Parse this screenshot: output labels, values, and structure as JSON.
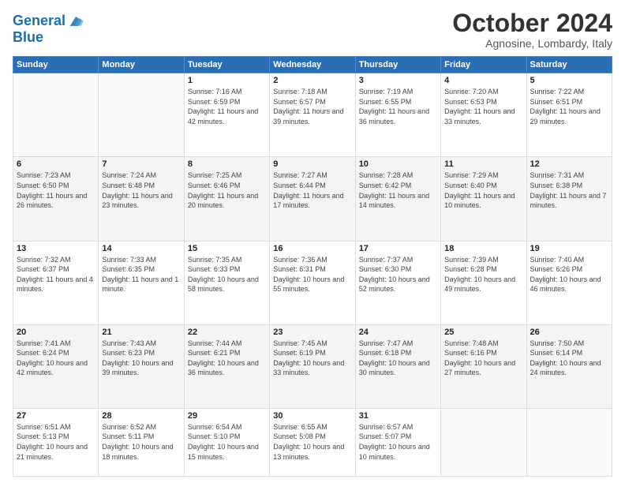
{
  "logo": {
    "line1": "General",
    "line2": "Blue"
  },
  "header": {
    "month": "October 2024",
    "location": "Agnosine, Lombardy, Italy"
  },
  "weekdays": [
    "Sunday",
    "Monday",
    "Tuesday",
    "Wednesday",
    "Thursday",
    "Friday",
    "Saturday"
  ],
  "weeks": [
    [
      {
        "day": "",
        "sunrise": "",
        "sunset": "",
        "daylight": ""
      },
      {
        "day": "",
        "sunrise": "",
        "sunset": "",
        "daylight": ""
      },
      {
        "day": "1",
        "sunrise": "Sunrise: 7:16 AM",
        "sunset": "Sunset: 6:59 PM",
        "daylight": "Daylight: 11 hours and 42 minutes."
      },
      {
        "day": "2",
        "sunrise": "Sunrise: 7:18 AM",
        "sunset": "Sunset: 6:57 PM",
        "daylight": "Daylight: 11 hours and 39 minutes."
      },
      {
        "day": "3",
        "sunrise": "Sunrise: 7:19 AM",
        "sunset": "Sunset: 6:55 PM",
        "daylight": "Daylight: 11 hours and 36 minutes."
      },
      {
        "day": "4",
        "sunrise": "Sunrise: 7:20 AM",
        "sunset": "Sunset: 6:53 PM",
        "daylight": "Daylight: 11 hours and 33 minutes."
      },
      {
        "day": "5",
        "sunrise": "Sunrise: 7:22 AM",
        "sunset": "Sunset: 6:51 PM",
        "daylight": "Daylight: 11 hours and 29 minutes."
      }
    ],
    [
      {
        "day": "6",
        "sunrise": "Sunrise: 7:23 AM",
        "sunset": "Sunset: 6:50 PM",
        "daylight": "Daylight: 11 hours and 26 minutes."
      },
      {
        "day": "7",
        "sunrise": "Sunrise: 7:24 AM",
        "sunset": "Sunset: 6:48 PM",
        "daylight": "Daylight: 11 hours and 23 minutes."
      },
      {
        "day": "8",
        "sunrise": "Sunrise: 7:25 AM",
        "sunset": "Sunset: 6:46 PM",
        "daylight": "Daylight: 11 hours and 20 minutes."
      },
      {
        "day": "9",
        "sunrise": "Sunrise: 7:27 AM",
        "sunset": "Sunset: 6:44 PM",
        "daylight": "Daylight: 11 hours and 17 minutes."
      },
      {
        "day": "10",
        "sunrise": "Sunrise: 7:28 AM",
        "sunset": "Sunset: 6:42 PM",
        "daylight": "Daylight: 11 hours and 14 minutes."
      },
      {
        "day": "11",
        "sunrise": "Sunrise: 7:29 AM",
        "sunset": "Sunset: 6:40 PM",
        "daylight": "Daylight: 11 hours and 10 minutes."
      },
      {
        "day": "12",
        "sunrise": "Sunrise: 7:31 AM",
        "sunset": "Sunset: 6:38 PM",
        "daylight": "Daylight: 11 hours and 7 minutes."
      }
    ],
    [
      {
        "day": "13",
        "sunrise": "Sunrise: 7:32 AM",
        "sunset": "Sunset: 6:37 PM",
        "daylight": "Daylight: 11 hours and 4 minutes."
      },
      {
        "day": "14",
        "sunrise": "Sunrise: 7:33 AM",
        "sunset": "Sunset: 6:35 PM",
        "daylight": "Daylight: 11 hours and 1 minute."
      },
      {
        "day": "15",
        "sunrise": "Sunrise: 7:35 AM",
        "sunset": "Sunset: 6:33 PM",
        "daylight": "Daylight: 10 hours and 58 minutes."
      },
      {
        "day": "16",
        "sunrise": "Sunrise: 7:36 AM",
        "sunset": "Sunset: 6:31 PM",
        "daylight": "Daylight: 10 hours and 55 minutes."
      },
      {
        "day": "17",
        "sunrise": "Sunrise: 7:37 AM",
        "sunset": "Sunset: 6:30 PM",
        "daylight": "Daylight: 10 hours and 52 minutes."
      },
      {
        "day": "18",
        "sunrise": "Sunrise: 7:39 AM",
        "sunset": "Sunset: 6:28 PM",
        "daylight": "Daylight: 10 hours and 49 minutes."
      },
      {
        "day": "19",
        "sunrise": "Sunrise: 7:40 AM",
        "sunset": "Sunset: 6:26 PM",
        "daylight": "Daylight: 10 hours and 46 minutes."
      }
    ],
    [
      {
        "day": "20",
        "sunrise": "Sunrise: 7:41 AM",
        "sunset": "Sunset: 6:24 PM",
        "daylight": "Daylight: 10 hours and 42 minutes."
      },
      {
        "day": "21",
        "sunrise": "Sunrise: 7:43 AM",
        "sunset": "Sunset: 6:23 PM",
        "daylight": "Daylight: 10 hours and 39 minutes."
      },
      {
        "day": "22",
        "sunrise": "Sunrise: 7:44 AM",
        "sunset": "Sunset: 6:21 PM",
        "daylight": "Daylight: 10 hours and 36 minutes."
      },
      {
        "day": "23",
        "sunrise": "Sunrise: 7:45 AM",
        "sunset": "Sunset: 6:19 PM",
        "daylight": "Daylight: 10 hours and 33 minutes."
      },
      {
        "day": "24",
        "sunrise": "Sunrise: 7:47 AM",
        "sunset": "Sunset: 6:18 PM",
        "daylight": "Daylight: 10 hours and 30 minutes."
      },
      {
        "day": "25",
        "sunrise": "Sunrise: 7:48 AM",
        "sunset": "Sunset: 6:16 PM",
        "daylight": "Daylight: 10 hours and 27 minutes."
      },
      {
        "day": "26",
        "sunrise": "Sunrise: 7:50 AM",
        "sunset": "Sunset: 6:14 PM",
        "daylight": "Daylight: 10 hours and 24 minutes."
      }
    ],
    [
      {
        "day": "27",
        "sunrise": "Sunrise: 6:51 AM",
        "sunset": "Sunset: 5:13 PM",
        "daylight": "Daylight: 10 hours and 21 minutes."
      },
      {
        "day": "28",
        "sunrise": "Sunrise: 6:52 AM",
        "sunset": "Sunset: 5:11 PM",
        "daylight": "Daylight: 10 hours and 18 minutes."
      },
      {
        "day": "29",
        "sunrise": "Sunrise: 6:54 AM",
        "sunset": "Sunset: 5:10 PM",
        "daylight": "Daylight: 10 hours and 15 minutes."
      },
      {
        "day": "30",
        "sunrise": "Sunrise: 6:55 AM",
        "sunset": "Sunset: 5:08 PM",
        "daylight": "Daylight: 10 hours and 13 minutes."
      },
      {
        "day": "31",
        "sunrise": "Sunrise: 6:57 AM",
        "sunset": "Sunset: 5:07 PM",
        "daylight": "Daylight: 10 hours and 10 minutes."
      },
      {
        "day": "",
        "sunrise": "",
        "sunset": "",
        "daylight": ""
      },
      {
        "day": "",
        "sunrise": "",
        "sunset": "",
        "daylight": ""
      }
    ]
  ]
}
